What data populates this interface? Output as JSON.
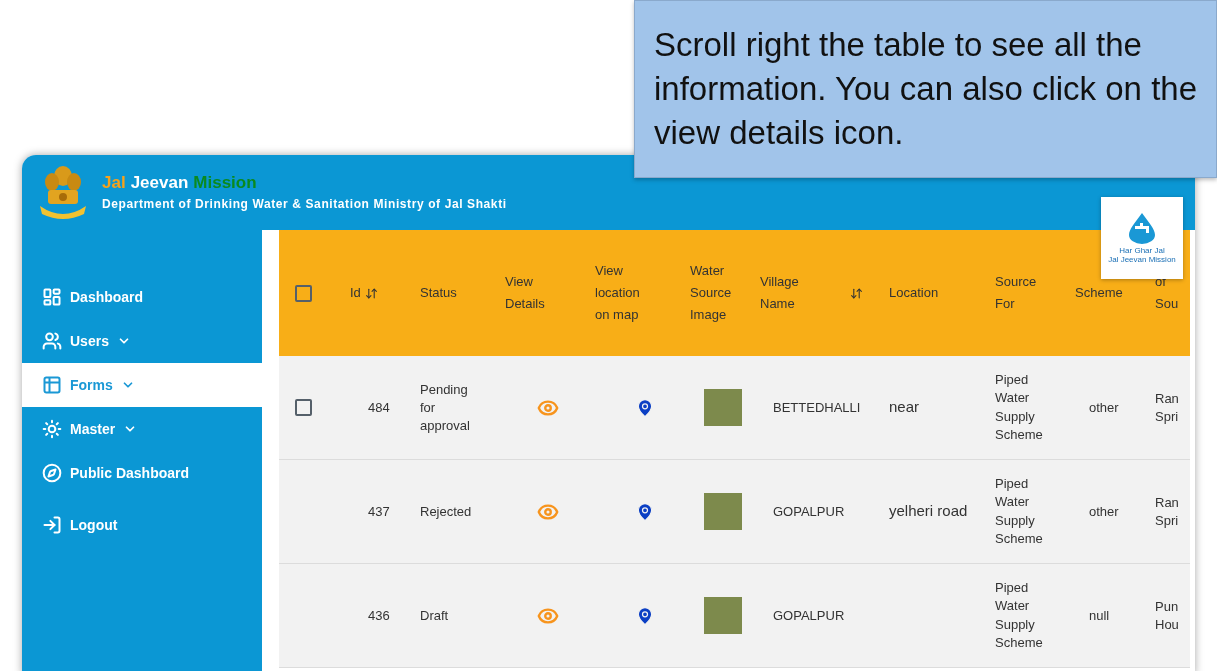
{
  "callout": {
    "text": "Scroll right the table to see all the information. You can also click on the view details icon."
  },
  "header": {
    "title": [
      {
        "text": "Jal",
        "color": "#f7a21b"
      },
      {
        "text": "Jeevan",
        "color": "#ffffff"
      },
      {
        "text": "Mission",
        "color": "#0a8a1e"
      }
    ],
    "subtitle": "Department of Drinking Water & Sanitation Ministry of Jal Shakti",
    "badge": {
      "line_1": "Har Ghar Jal",
      "line_2": "Jal Jeevan Mission"
    }
  },
  "sidebar": {
    "items": [
      {
        "label": "Dashboard",
        "expandable": false,
        "selected": false
      },
      {
        "label": "Users",
        "expandable": true,
        "selected": false
      },
      {
        "label": "Forms",
        "expandable": true,
        "selected": true
      },
      {
        "label": "Master",
        "expandable": true,
        "selected": false
      },
      {
        "label": "Public Dashboard",
        "expandable": false,
        "selected": false
      },
      {
        "label": "Logout",
        "expandable": false,
        "selected": false
      }
    ]
  },
  "table": {
    "header_checked": false,
    "columns": [
      {
        "label": "Id",
        "sortable": true
      },
      {
        "label": "Status"
      },
      {
        "label": "View Details"
      },
      {
        "label": "View location on map"
      },
      {
        "label": "Water Source Image"
      },
      {
        "label": "Village Name",
        "sortable": true
      },
      {
        "label": "Location"
      },
      {
        "label": "Source For"
      },
      {
        "label": "Scheme"
      },
      {
        "label": "of Sou"
      }
    ],
    "rows": [
      {
        "checkbox": {
          "checked": false
        },
        "id": "484",
        "status": "Pending for approval",
        "village": "BETTEDHALLI",
        "location": "near",
        "source_for": "Piped Water Supply Scheme",
        "scheme": "other",
        "column_10": "Ran Spri"
      },
      {
        "id": "437",
        "status": "Rejected",
        "village": "GOPALPUR",
        "location": "yelheri road",
        "source_for": "Piped Water Supply Scheme",
        "scheme": "other",
        "column_10": "Ran Spri"
      },
      {
        "id": "436",
        "status": "Draft",
        "village": "GOPALPUR",
        "source_for": "Piped Water Supply Scheme",
        "scheme": "null",
        "column_10": "Pun Hou"
      }
    ]
  }
}
